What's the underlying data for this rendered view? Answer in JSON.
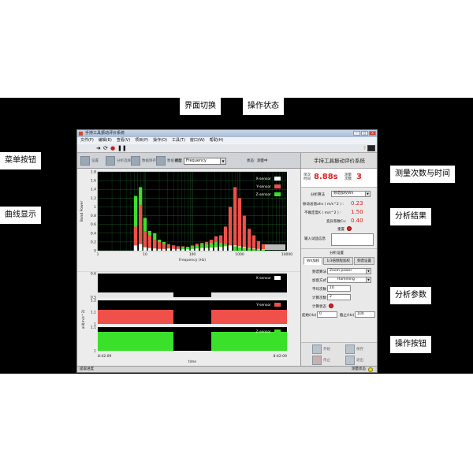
{
  "callouts": {
    "view_switch": "界面切换",
    "op_status": "操作状态",
    "menu_buttons": "菜单按钮",
    "curve_display": "曲线显示",
    "count_time": "测量次数与时间",
    "analysis_result": "分析结果",
    "analysis_params": "分析参数",
    "op_buttons": "操作按钮"
  },
  "window": {
    "title": "手持工具振动评价系统",
    "menu": [
      "文件(F)",
      "编辑(E)",
      "查看(V)",
      "项目(P)",
      "操作(O)",
      "工具(T)",
      "窗口(W)",
      "帮助(H)"
    ]
  },
  "toolbar": {
    "settings_label": "设置",
    "btn2_label": "分析选择",
    "btn3_label": "数据保存",
    "btn4_label": "数据查询",
    "mode_label": "模型",
    "mode_value": "Frequency",
    "status_label": "状态:",
    "status_value": "测量中"
  },
  "colors": {
    "red": "#f0504a",
    "green": "#3be02a",
    "plot_bg": "#000000",
    "grid": "#1f6f2f",
    "accent_red": "#e02020"
  },
  "chart_data": [
    {
      "type": "bar",
      "xscale": "log",
      "xlim": [
        1,
        10000
      ],
      "ylim": [
        0,
        1.8
      ],
      "xlabel": "Frequency (Hz)",
      "ylabel": "Band Power",
      "xticks": [
        "1",
        "10",
        "100",
        "1000",
        "10000"
      ],
      "yticks": [
        "0",
        "0.2",
        "0.4",
        "0.6",
        "0.8",
        "1",
        "1.2",
        "1.4",
        "1.6",
        "1.8"
      ],
      "x": [
        6.3,
        8,
        10,
        12.5,
        16,
        20,
        25,
        31.5,
        40,
        50,
        63,
        80,
        100,
        125,
        160,
        200,
        250,
        315,
        400,
        500,
        630,
        800,
        1000,
        1250,
        1600,
        2000,
        2500,
        3150
      ],
      "series": [
        {
          "name": "X-sensor",
          "values": [
            0.12,
            0.15,
            0.08,
            0.06,
            0.05,
            0.04,
            0.04,
            0.05,
            0.04,
            0.04,
            0.03,
            0.03,
            0.04,
            0.05,
            0.06,
            0.06,
            0.07,
            0.08,
            0.09,
            0.1,
            0.12,
            0.12,
            0.1,
            0.08,
            0.06,
            0.05,
            0.04,
            0.03
          ]
        },
        {
          "name": "Y-sensor",
          "values": [
            0.55,
            1.05,
            0.45,
            0.35,
            0.25,
            0.2,
            0.15,
            0.14,
            0.12,
            0.1,
            0.1,
            0.09,
            0.12,
            0.16,
            0.18,
            0.2,
            0.25,
            0.33,
            0.35,
            0.55,
            1.0,
            1.45,
            1.2,
            0.8,
            0.5,
            0.35,
            0.22,
            0.15
          ]
        },
        {
          "name": "Z-sensor",
          "values": [
            1.25,
            1.45,
            0.75,
            0.45,
            0.4,
            0.25,
            0.2,
            0.15,
            0.12,
            0.1,
            0.08,
            0.08,
            0.1,
            0.12,
            0.15,
            0.15,
            0.18,
            0.2,
            0.18,
            0.15,
            0.12,
            0.1,
            0.08,
            0.06,
            0.05,
            0.04,
            0.03,
            0.02
          ]
        }
      ]
    },
    {
      "type": "line",
      "xlabel": "time",
      "x_ticks": [
        "8:42:09",
        "8:42:09"
      ],
      "panels": [
        {
          "name": "X-sensor",
          "ylabel": "aH(m/s^2)",
          "ylim": [
            0.5,
            0.6
          ],
          "yticks": [
            "0.6",
            "0.5"
          ],
          "segments": [
            [
              0,
              0.52
            ],
            [
              0.4,
              0.52
            ],
            [
              0.4,
              0.5
            ],
            [
              0.6,
              0.5
            ],
            [
              0.6,
              0.52
            ],
            [
              1,
              0.52
            ]
          ]
        },
        {
          "name": "Y-sensor",
          "ylabel": "aH(m/s^2)",
          "ylim": [
            1.0,
            1.2
          ],
          "yticks": [
            "1.2",
            "1.1",
            "1"
          ],
          "segments": [
            [
              0,
              1.12
            ],
            [
              0.4,
              1.12
            ],
            [
              0.4,
              1.0
            ],
            [
              0.6,
              1.0
            ],
            [
              0.6,
              1.12
            ],
            [
              1,
              1.12
            ]
          ]
        },
        {
          "name": "Z-sensor",
          "ylabel": "aH(m/s^2)",
          "ylim": [
            1.0,
            1.1
          ],
          "yticks": [
            "1.1",
            "1"
          ],
          "segments": [
            [
              0,
              1.08
            ],
            [
              0.4,
              1.08
            ],
            [
              0.4,
              1.0
            ],
            [
              0.6,
              1.0
            ],
            [
              0.6,
              1.08
            ],
            [
              1,
              1.08
            ]
          ]
        }
      ]
    }
  ],
  "right_panel": {
    "title": "手持工具振动评价系统",
    "single_time_label": "单次时间",
    "single_time_value": "8.88s",
    "count_label": "测量次数",
    "count_value": "3",
    "method_label": "分析算法",
    "method_value": "频谱加权Wh",
    "ahv_label": "振动总值ahv ( m/s^2 ) :",
    "ahv_value": "0.23",
    "k_label": "不确定度K ( m/s^2 ) :",
    "k_value": "1.50",
    "cv_label": "变异系数Cv:",
    "cv_value": "0.40",
    "reset_label": "重置",
    "input_label": "输入试品信息",
    "params_title": "分析设置",
    "tab1": "Wh加权",
    "tab2": "1/3倍频程加权",
    "tab3": "频谱设置",
    "zoom_label": "频谱算法",
    "zoom_value": "Zoom power",
    "window_label": "加窗方式",
    "window_value": "Hamming",
    "avg_label": "平均次数",
    "avg_value": "10",
    "calc_label": "计算次数",
    "calc_value": "2",
    "calc_status_label": "计算状态",
    "start_label": "起始(Hz)",
    "start_value": "0",
    "stop_label": "截止(Hz)",
    "stop_value": "100",
    "op_start": "开始",
    "op_save": "保存",
    "op_stop": "停止",
    "op_exit": "退出"
  },
  "status_bar": {
    "left": "提取进度",
    "right": "测量状态"
  }
}
